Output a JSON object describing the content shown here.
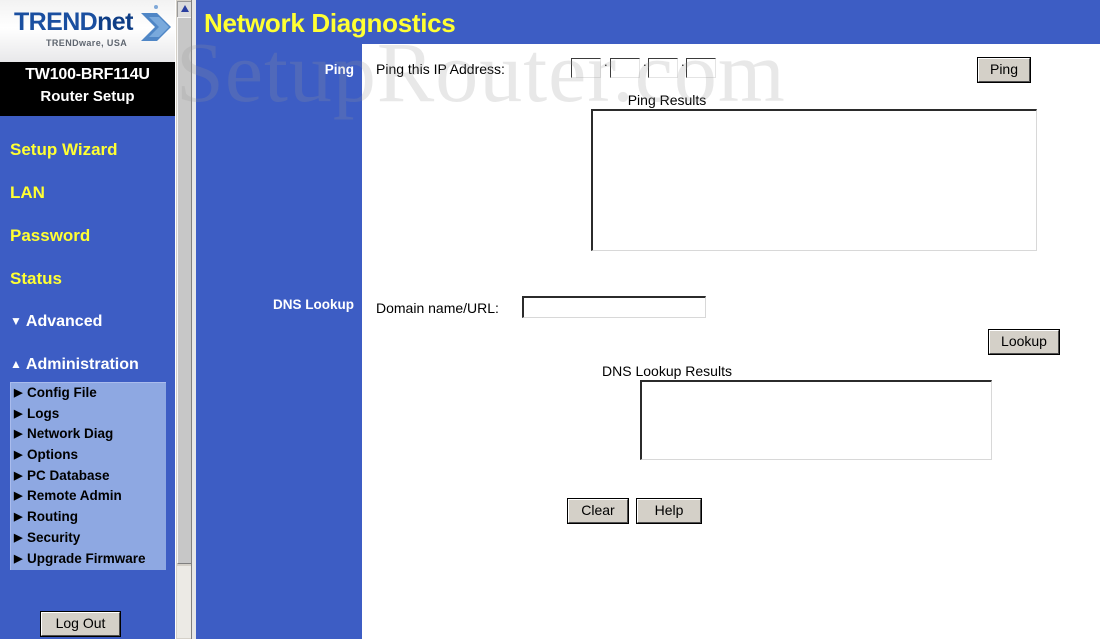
{
  "brand": {
    "logo_main": "TRENDnet",
    "logo_trend": "TREND",
    "logo_net": "net",
    "logo_sub": "TRENDware, USA",
    "model": "TW100-BRF114U",
    "model_sub": "Router Setup"
  },
  "watermark": "SetupRouter.com",
  "sidebar": {
    "main_items": [
      {
        "label": "Setup Wizard"
      },
      {
        "label": "LAN"
      },
      {
        "label": "Password"
      },
      {
        "label": "Status"
      }
    ],
    "sections": [
      {
        "label": "Advanced",
        "marker": "▼",
        "expanded": false
      },
      {
        "label": "Administration",
        "marker": "▲",
        "expanded": true
      }
    ],
    "submenu": [
      {
        "label": "Config File"
      },
      {
        "label": "Logs"
      },
      {
        "label": "Network Diag"
      },
      {
        "label": "Options"
      },
      {
        "label": "PC Database"
      },
      {
        "label": "Remote Admin"
      },
      {
        "label": "Routing"
      },
      {
        "label": "Security"
      },
      {
        "label": "Upgrade Firmware"
      }
    ],
    "logout_label": "Log Out"
  },
  "header": {
    "title": "Network Diagnostics"
  },
  "ping": {
    "section_label": "Ping",
    "ip_label": "Ping this IP Address:",
    "octets": [
      "",
      "",
      "",
      ""
    ],
    "separator": ".",
    "button_label": "Ping",
    "results_label": "Ping Results",
    "results_value": ""
  },
  "dns": {
    "section_label": "DNS Lookup",
    "domain_label": "Domain name/URL:",
    "domain_value": "",
    "domain_placeholder": "",
    "button_label": "Lookup",
    "results_label": "DNS Lookup Results",
    "results_value": ""
  },
  "footer": {
    "clear_label": "Clear",
    "help_label": "Help"
  },
  "colors": {
    "brand_blue": "#3D5DC4",
    "nav_yellow": "#FFFF33",
    "submenu_blue": "#8EA8E2",
    "button_face": "#d4d0c8"
  }
}
